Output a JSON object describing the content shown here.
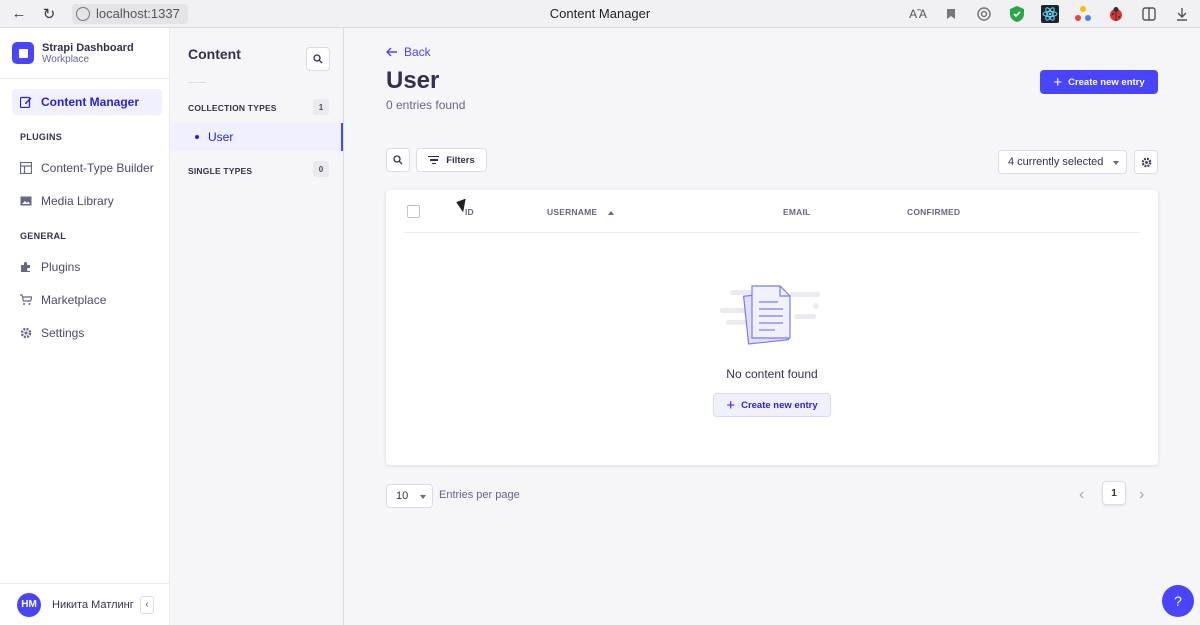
{
  "browser": {
    "url": "localhost:1337",
    "title": "Content Manager"
  },
  "sidebar": {
    "brand_title": "Strapi Dashboard",
    "brand_sub": "Workplace",
    "items": [
      {
        "label": "Content Manager",
        "icon": "pencil-icon",
        "active": true
      },
      {
        "label": "Content-Type Builder",
        "icon": "layout-icon"
      },
      {
        "label": "Media Library",
        "icon": "image-icon"
      },
      {
        "label": "Plugins",
        "icon": "puzzle-icon"
      },
      {
        "label": "Marketplace",
        "icon": "cart-icon"
      },
      {
        "label": "Settings",
        "icon": "gear-icon"
      }
    ],
    "section_plugins": "PLUGINS",
    "section_general": "GENERAL",
    "user_initials": "HM",
    "user_name": "Никита Матлинг"
  },
  "subnav": {
    "title": "Content",
    "collection_types": "COLLECTION TYPES",
    "collection_count": "1",
    "collection_item": "User",
    "single_types": "SINGLE TYPES",
    "single_count": "0"
  },
  "main": {
    "back": "Back",
    "title": "User",
    "entries_found": "0 entries found",
    "create_button": "Create new entry",
    "filters": "Filters",
    "columns_select": "4 currently selected",
    "table_headers": [
      "ID",
      "USERNAME",
      "EMAIL",
      "CONFIRMED"
    ],
    "empty_text": "No content found",
    "empty_create_button": "Create new entry",
    "per_page_value": "10",
    "per_page_label": "Entries per page",
    "current_page": "1",
    "help": "?"
  },
  "colors": {
    "primary": "#4945ff",
    "primary_light": "#f0f0ff",
    "text": "#32324d",
    "muted": "#666687"
  }
}
